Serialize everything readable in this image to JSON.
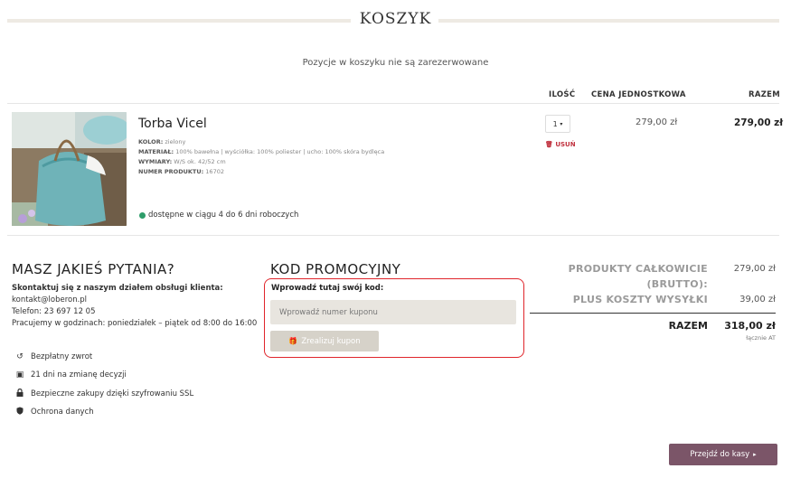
{
  "header": {
    "title": "KOSZYK"
  },
  "notice": "Pozycje w koszyku nie są zarezerwowane",
  "columns": {
    "qty": "ILOŚĆ",
    "unit_price": "CENA JEDNOSTKOWA",
    "total": "RAZEM"
  },
  "item": {
    "name": "Torba Vicel",
    "attributes": [
      {
        "label": "KOLOR:",
        "value": "zielony"
      },
      {
        "label": "MATERIAŁ:",
        "value": "100% bawełna | wyściółka: 100% poliester | ucho: 100% skóra bydlęca"
      },
      {
        "label": "WYMIARY:",
        "value": "W/S ok. 42/52 cm"
      },
      {
        "label": "NUMER PRODUKTU:",
        "value": "16702"
      }
    ],
    "quantity": "1",
    "remove_label": "USUŃ",
    "unit_price": "279,00 zł",
    "line_total": "279,00 zł",
    "availability": "dostępne w ciągu 4 do 6 dni roboczych"
  },
  "help": {
    "title": "MASZ JAKIEŚ PYTANIA?",
    "contact_heading": "Skontaktuj się z naszym działem obsługi klienta:",
    "email": "kontakt@loberon.pl",
    "phone": "Telefon: 23 697 12 05",
    "hours": "Pracujemy w godzinach: poniedziałek – piątek od 8:00 do 16:00",
    "features": [
      {
        "icon": "return-icon",
        "label": "Bezpłatny zwrot"
      },
      {
        "icon": "calendar-icon",
        "label": "21 dni na zmianę decyzji"
      },
      {
        "icon": "lock-icon",
        "label": "Bezpieczne zakupy dzięki szyfrowaniu SSL"
      },
      {
        "icon": "shield-icon",
        "label": "Ochrona danych"
      }
    ]
  },
  "promo": {
    "title": "KOD PROMOCYJNY",
    "label": "Wprowadź tutaj swój kod:",
    "placeholder": "Wprowadź numer kuponu",
    "button": "Zrealizuj kupon"
  },
  "summary": {
    "products_label_1": "PRODUKTY CAŁKOWICIE",
    "products_label_2": "(BRUTTO):",
    "products_value": "279,00 zł",
    "shipping_label": "PLUS KOSZTY WYSYŁKI",
    "shipping_value": "39,00 zł",
    "total_label": "RAZEM",
    "total_value": "318,00 zł",
    "vat_note": "łącznie AT"
  },
  "checkout": {
    "label": "Przejdź do kasy"
  },
  "colors": {
    "accent_red": "#e0252b",
    "checkout_bg": "#7b5568",
    "available_green": "#2e9d6a"
  }
}
